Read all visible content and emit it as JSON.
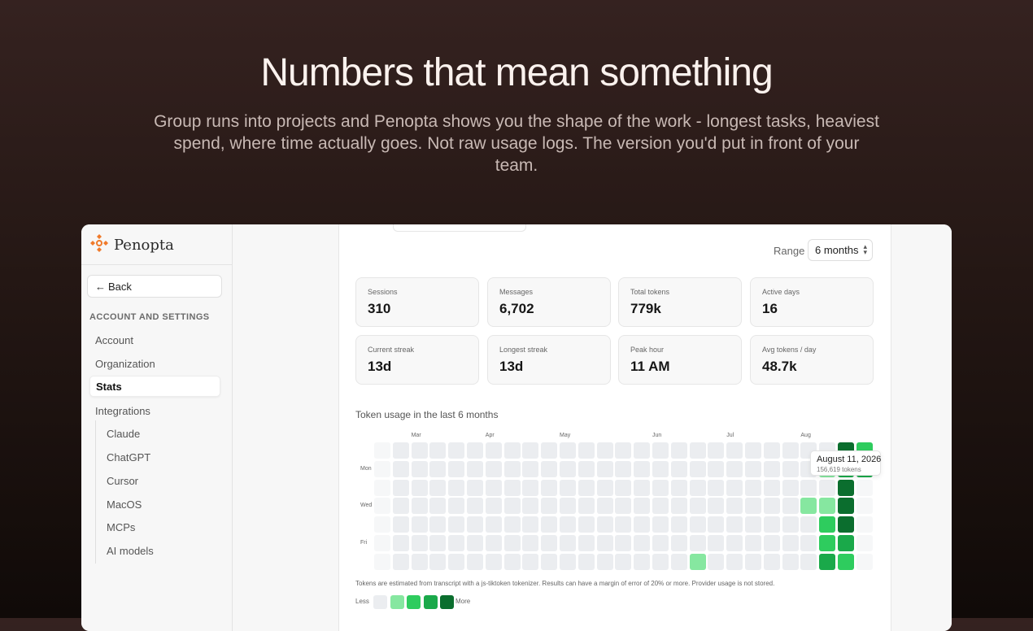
{
  "hero": {
    "title": "Numbers that mean something",
    "subtitle": "Group runs into projects and Penopta shows you the shape of the work - longest tasks, heaviest spend, where time actually goes. Not raw usage logs. The version you'd put in front of your team."
  },
  "brand": {
    "name": "Penopta",
    "logo_icon": "penopta-logo-icon",
    "accent": "#f07a2a"
  },
  "sidebar": {
    "back_label": "Back",
    "back_icon": "arrow-left-icon",
    "heading": "ACCOUNT AND SETTINGS",
    "items": [
      {
        "label": "Account"
      },
      {
        "label": "Organization"
      },
      {
        "label": "Stats",
        "active": true
      },
      {
        "label": "Integrations"
      }
    ],
    "integrations": [
      {
        "label": "Claude"
      },
      {
        "label": "ChatGPT"
      },
      {
        "label": "Cursor"
      },
      {
        "label": "MacOS"
      },
      {
        "label": "MCPs"
      },
      {
        "label": "AI models"
      }
    ]
  },
  "range": {
    "label": "Range",
    "selected": "6 months",
    "icon": "chevron-updown-icon"
  },
  "stats": [
    {
      "label": "Sessions",
      "value": "310"
    },
    {
      "label": "Messages",
      "value": "6,702"
    },
    {
      "label": "Total tokens",
      "value": "779k"
    },
    {
      "label": "Active days",
      "value": "16"
    },
    {
      "label": "Current streak",
      "value": "13d"
    },
    {
      "label": "Longest streak",
      "value": "13d"
    },
    {
      "label": "Peak hour",
      "value": "11 AM"
    },
    {
      "label": "Avg tokens / day",
      "value": "48.7k"
    }
  ],
  "heatmap": {
    "title": "Token usage in the last 6 months",
    "months": [
      {
        "label": "Mar",
        "week": 2
      },
      {
        "label": "Apr",
        "week": 6
      },
      {
        "label": "May",
        "week": 10
      },
      {
        "label": "Jun",
        "week": 15
      },
      {
        "label": "Jul",
        "week": 19
      },
      {
        "label": "Aug",
        "week": 23
      }
    ],
    "day_labels": [
      {
        "label": "Mon",
        "row": 1
      },
      {
        "label": "Wed",
        "row": 3
      },
      {
        "label": "Fri",
        "row": 5
      }
    ],
    "weeks": 26,
    "start_row_first_week": 0,
    "levels": [
      "#ebedf0",
      "#86e7a0",
      "#2ecc5e",
      "#1aa94a",
      "#0b6e2e"
    ],
    "active_cells": [
      {
        "week": 17,
        "row": 6,
        "level": 1
      },
      {
        "week": 23,
        "row": 3,
        "level": 1
      },
      {
        "week": 24,
        "row": 3,
        "level": 1
      },
      {
        "week": 24,
        "row": 4,
        "level": 2
      },
      {
        "week": 24,
        "row": 5,
        "level": 2
      },
      {
        "week": 24,
        "row": 6,
        "level": 3
      },
      {
        "week": 24,
        "row": 1,
        "level": 1
      },
      {
        "week": 25,
        "row": 0,
        "level": 4
      },
      {
        "week": 25,
        "row": 1,
        "level": 3
      },
      {
        "week": 25,
        "row": 2,
        "level": 4
      },
      {
        "week": 25,
        "row": 3,
        "level": 4
      },
      {
        "week": 25,
        "row": 4,
        "level": 4
      },
      {
        "week": 25,
        "row": 5,
        "level": 3
      },
      {
        "week": 25,
        "row": 6,
        "level": 2
      },
      {
        "week": 26,
        "row": 0,
        "level": 2
      },
      {
        "week": 26,
        "row": 1,
        "level": 3
      }
    ],
    "tooltip": {
      "date": "August 11, 2026",
      "tokens": "156,619 tokens"
    },
    "footnote": "Tokens are estimated from transcript with a js-tiktoken tokenizer. Results can have a margin of error of 20% or more. Provider usage is not stored.",
    "legend_less": "Less",
    "legend_more": "More"
  }
}
